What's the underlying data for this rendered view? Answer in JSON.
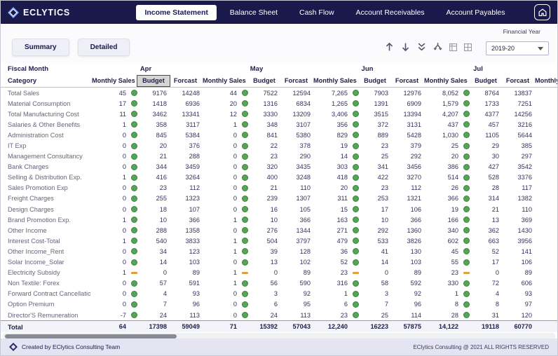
{
  "app": {
    "brand": "ECLYTICS",
    "nav_tabs": [
      {
        "label": "Income Statement",
        "active": true
      },
      {
        "label": "Balance Sheet",
        "active": false
      },
      {
        "label": "Cash Flow",
        "active": false
      },
      {
        "label": "Account Receivables",
        "active": false
      },
      {
        "label": "Account Payables",
        "active": false
      }
    ],
    "icons": {
      "home": "home-icon",
      "logo": "eclytics-diamond-logo",
      "drill": [
        "drill-up-arrow",
        "drill-down-arrow",
        "go-to-next-level-double-arrow",
        "expand-all-fork-arrow",
        "matrix-mini-1",
        "matrix-mini-2"
      ]
    },
    "colors": {
      "navy": "#19194B",
      "kpi_green": "#55A555",
      "kpi_orange": "#DFA136",
      "footer_bg": "#E4E4F3"
    }
  },
  "controls": {
    "summary_label": "Summary",
    "detailed_label": "Detailed",
    "financial_year_label": "Financial Year",
    "year_value": "2019-20"
  },
  "table": {
    "corner_top": "Fiscal Month",
    "corner_bottom": "Category",
    "months": [
      "Apr",
      "May",
      "Jun",
      "Jul"
    ],
    "partial_month": "",
    "partial_column": "Monthly Sales",
    "sub_columns": [
      "Monthly Sales",
      "Budget",
      "Forcast"
    ],
    "selected_header": {
      "month": "Apr",
      "column": "Budget"
    },
    "rows": [
      {
        "category": "Total Sales",
        "cells": [
          {
            "sales": "45",
            "ind": "green",
            "budget": "9176",
            "forcast": "14248"
          },
          {
            "sales": "44",
            "ind": "green",
            "budget": "7522",
            "forcast": "12594"
          },
          {
            "sales": "7,265",
            "ind": "green",
            "budget": "7903",
            "forcast": "12976"
          },
          {
            "sales": "8,052",
            "ind": "green",
            "budget": "8764",
            "forcast": "13837"
          }
        ]
      },
      {
        "category": "Material Consumption",
        "cells": [
          {
            "sales": "17",
            "ind": "green",
            "budget": "1418",
            "forcast": "6936"
          },
          {
            "sales": "20",
            "ind": "green",
            "budget": "1316",
            "forcast": "6834"
          },
          {
            "sales": "1,265",
            "ind": "green",
            "budget": "1391",
            "forcast": "6909"
          },
          {
            "sales": "1,579",
            "ind": "green",
            "budget": "1733",
            "forcast": "7251"
          }
        ]
      },
      {
        "category": "Total Manufacturing Cost",
        "cells": [
          {
            "sales": "11",
            "ind": "green",
            "budget": "3462",
            "forcast": "13341"
          },
          {
            "sales": "12",
            "ind": "green",
            "budget": "3330",
            "forcast": "13209"
          },
          {
            "sales": "3,406",
            "ind": "green",
            "budget": "3515",
            "forcast": "13394"
          },
          {
            "sales": "4,207",
            "ind": "green",
            "budget": "4377",
            "forcast": "14256"
          }
        ]
      },
      {
        "category": "Salaries & Other Benefits",
        "cells": [
          {
            "sales": "1",
            "ind": "green",
            "budget": "358",
            "forcast": "3117"
          },
          {
            "sales": "1",
            "ind": "green",
            "budget": "348",
            "forcast": "3107"
          },
          {
            "sales": "356",
            "ind": "green",
            "budget": "372",
            "forcast": "3131"
          },
          {
            "sales": "437",
            "ind": "green",
            "budget": "457",
            "forcast": "3216"
          }
        ]
      },
      {
        "category": "Administration Cost",
        "cells": [
          {
            "sales": "0",
            "ind": "green",
            "budget": "845",
            "forcast": "5384"
          },
          {
            "sales": "0",
            "ind": "green",
            "budget": "841",
            "forcast": "5380"
          },
          {
            "sales": "829",
            "ind": "green",
            "budget": "889",
            "forcast": "5428"
          },
          {
            "sales": "1,030",
            "ind": "green",
            "budget": "1105",
            "forcast": "5644"
          }
        ]
      },
      {
        "category": "IT Exp",
        "cells": [
          {
            "sales": "0",
            "ind": "green",
            "budget": "20",
            "forcast": "376"
          },
          {
            "sales": "0",
            "ind": "green",
            "budget": "22",
            "forcast": "378"
          },
          {
            "sales": "19",
            "ind": "green",
            "budget": "23",
            "forcast": "379"
          },
          {
            "sales": "25",
            "ind": "green",
            "budget": "29",
            "forcast": "385"
          }
        ]
      },
      {
        "category": "Management Consultancy",
        "cells": [
          {
            "sales": "0",
            "ind": "green",
            "budget": "21",
            "forcast": "288"
          },
          {
            "sales": "0",
            "ind": "green",
            "budget": "23",
            "forcast": "290"
          },
          {
            "sales": "14",
            "ind": "green",
            "budget": "25",
            "forcast": "292"
          },
          {
            "sales": "20",
            "ind": "green",
            "budget": "30",
            "forcast": "297"
          }
        ]
      },
      {
        "category": "Bank Charges",
        "cells": [
          {
            "sales": "0",
            "ind": "green",
            "budget": "344",
            "forcast": "3459"
          },
          {
            "sales": "0",
            "ind": "green",
            "budget": "320",
            "forcast": "3435"
          },
          {
            "sales": "303",
            "ind": "green",
            "budget": "341",
            "forcast": "3456"
          },
          {
            "sales": "386",
            "ind": "green",
            "budget": "427",
            "forcast": "3542"
          }
        ]
      },
      {
        "category": "Selling & Distribution Exp.",
        "cells": [
          {
            "sales": "1",
            "ind": "green",
            "budget": "416",
            "forcast": "3264"
          },
          {
            "sales": "0",
            "ind": "green",
            "budget": "400",
            "forcast": "3248"
          },
          {
            "sales": "418",
            "ind": "green",
            "budget": "422",
            "forcast": "3270"
          },
          {
            "sales": "514",
            "ind": "green",
            "budget": "528",
            "forcast": "3376"
          }
        ]
      },
      {
        "category": "Sales Promotion Exp",
        "cells": [
          {
            "sales": "0",
            "ind": "green",
            "budget": "23",
            "forcast": "112"
          },
          {
            "sales": "0",
            "ind": "green",
            "budget": "21",
            "forcast": "110"
          },
          {
            "sales": "20",
            "ind": "green",
            "budget": "23",
            "forcast": "112"
          },
          {
            "sales": "26",
            "ind": "green",
            "budget": "28",
            "forcast": "117"
          }
        ]
      },
      {
        "category": "Freight Charges",
        "cells": [
          {
            "sales": "0",
            "ind": "green",
            "budget": "255",
            "forcast": "1323"
          },
          {
            "sales": "0",
            "ind": "green",
            "budget": "239",
            "forcast": "1307"
          },
          {
            "sales": "311",
            "ind": "green",
            "budget": "253",
            "forcast": "1321"
          },
          {
            "sales": "366",
            "ind": "green",
            "budget": "314",
            "forcast": "1382"
          }
        ]
      },
      {
        "category": "Design Charges",
        "cells": [
          {
            "sales": "0",
            "ind": "green",
            "budget": "18",
            "forcast": "107"
          },
          {
            "sales": "0",
            "ind": "green",
            "budget": "16",
            "forcast": "105"
          },
          {
            "sales": "15",
            "ind": "green",
            "budget": "17",
            "forcast": "106"
          },
          {
            "sales": "19",
            "ind": "green",
            "budget": "21",
            "forcast": "110"
          }
        ]
      },
      {
        "category": "Brand Promotion Exp.",
        "cells": [
          {
            "sales": "1",
            "ind": "green",
            "budget": "10",
            "forcast": "366"
          },
          {
            "sales": "1",
            "ind": "green",
            "budget": "10",
            "forcast": "366"
          },
          {
            "sales": "163",
            "ind": "green",
            "budget": "10",
            "forcast": "366"
          },
          {
            "sales": "166",
            "ind": "green",
            "budget": "13",
            "forcast": "369"
          }
        ]
      },
      {
        "category": "Other Income",
        "cells": [
          {
            "sales": "0",
            "ind": "green",
            "budget": "288",
            "forcast": "1358"
          },
          {
            "sales": "0",
            "ind": "green",
            "budget": "276",
            "forcast": "1344"
          },
          {
            "sales": "271",
            "ind": "green",
            "budget": "292",
            "forcast": "1360"
          },
          {
            "sales": "340",
            "ind": "green",
            "budget": "362",
            "forcast": "1430"
          }
        ]
      },
      {
        "category": "Interest Cost-Total",
        "cells": [
          {
            "sales": "1",
            "ind": "green",
            "budget": "540",
            "forcast": "3833"
          },
          {
            "sales": "1",
            "ind": "green",
            "budget": "504",
            "forcast": "3797"
          },
          {
            "sales": "479",
            "ind": "green",
            "budget": "533",
            "forcast": "3826"
          },
          {
            "sales": "602",
            "ind": "green",
            "budget": "663",
            "forcast": "3956"
          }
        ]
      },
      {
        "category": "Other Income_Rent",
        "cells": [
          {
            "sales": "0",
            "ind": "green",
            "budget": "34",
            "forcast": "123"
          },
          {
            "sales": "1",
            "ind": "green",
            "budget": "39",
            "forcast": "128"
          },
          {
            "sales": "36",
            "ind": "green",
            "budget": "41",
            "forcast": "130"
          },
          {
            "sales": "45",
            "ind": "green",
            "budget": "52",
            "forcast": "141"
          }
        ]
      },
      {
        "category": "Solar Income_Solar",
        "cells": [
          {
            "sales": "0",
            "ind": "green",
            "budget": "14",
            "forcast": "103"
          },
          {
            "sales": "0",
            "ind": "green",
            "budget": "13",
            "forcast": "102"
          },
          {
            "sales": "52",
            "ind": "green",
            "budget": "14",
            "forcast": "103"
          },
          {
            "sales": "55",
            "ind": "green",
            "budget": "17",
            "forcast": "106"
          }
        ]
      },
      {
        "category": "Electricity Subsidy",
        "cells": [
          {
            "sales": "1",
            "ind": "orange",
            "budget": "0",
            "forcast": "89"
          },
          {
            "sales": "1",
            "ind": "orange",
            "budget": "0",
            "forcast": "89"
          },
          {
            "sales": "23",
            "ind": "orange",
            "budget": "0",
            "forcast": "89"
          },
          {
            "sales": "23",
            "ind": "orange",
            "budget": "0",
            "forcast": "89"
          }
        ]
      },
      {
        "category": "Non Textile: Forex",
        "cells": [
          {
            "sales": "0",
            "ind": "green",
            "budget": "57",
            "forcast": "591"
          },
          {
            "sales": "1",
            "ind": "green",
            "budget": "56",
            "forcast": "590"
          },
          {
            "sales": "316",
            "ind": "green",
            "budget": "58",
            "forcast": "592"
          },
          {
            "sales": "330",
            "ind": "green",
            "budget": "72",
            "forcast": "606"
          }
        ]
      },
      {
        "category": "Forward Contract Cancellation",
        "cells": [
          {
            "sales": "0",
            "ind": "green",
            "budget": "4",
            "forcast": "93"
          },
          {
            "sales": "0",
            "ind": "green",
            "budget": "3",
            "forcast": "92"
          },
          {
            "sales": "1",
            "ind": "green",
            "budget": "3",
            "forcast": "92"
          },
          {
            "sales": "1",
            "ind": "green",
            "budget": "4",
            "forcast": "93"
          }
        ]
      },
      {
        "category": "Option Premium",
        "cells": [
          {
            "sales": "0",
            "ind": "green",
            "budget": "7",
            "forcast": "96"
          },
          {
            "sales": "0",
            "ind": "green",
            "budget": "6",
            "forcast": "95"
          },
          {
            "sales": "6",
            "ind": "green",
            "budget": "7",
            "forcast": "96"
          },
          {
            "sales": "8",
            "ind": "green",
            "budget": "8",
            "forcast": "97"
          }
        ]
      },
      {
        "category": "Director'S Remuneration",
        "cells": [
          {
            "sales": "-7",
            "ind": "green",
            "budget": "24",
            "forcast": "113"
          },
          {
            "sales": "0",
            "ind": "green",
            "budget": "24",
            "forcast": "113"
          },
          {
            "sales": "23",
            "ind": "green",
            "budget": "25",
            "forcast": "114"
          },
          {
            "sales": "28",
            "ind": "green",
            "budget": "31",
            "forcast": "120"
          }
        ]
      }
    ],
    "total": {
      "label": "Total",
      "cells": [
        {
          "sales": "64",
          "budget": "17398",
          "forcast": "59049"
        },
        {
          "sales": "71",
          "budget": "15392",
          "forcast": "57043"
        },
        {
          "sales": "12,240",
          "budget": "16223",
          "forcast": "57875"
        },
        {
          "sales": "14,122",
          "budget": "19118",
          "forcast": "60770"
        }
      ]
    }
  },
  "footer": {
    "left_text": "Created by EClytics  Consulting Team",
    "right_text": "EClytics Consulting @ 2021 ALL RIGHTS RESERVED"
  }
}
